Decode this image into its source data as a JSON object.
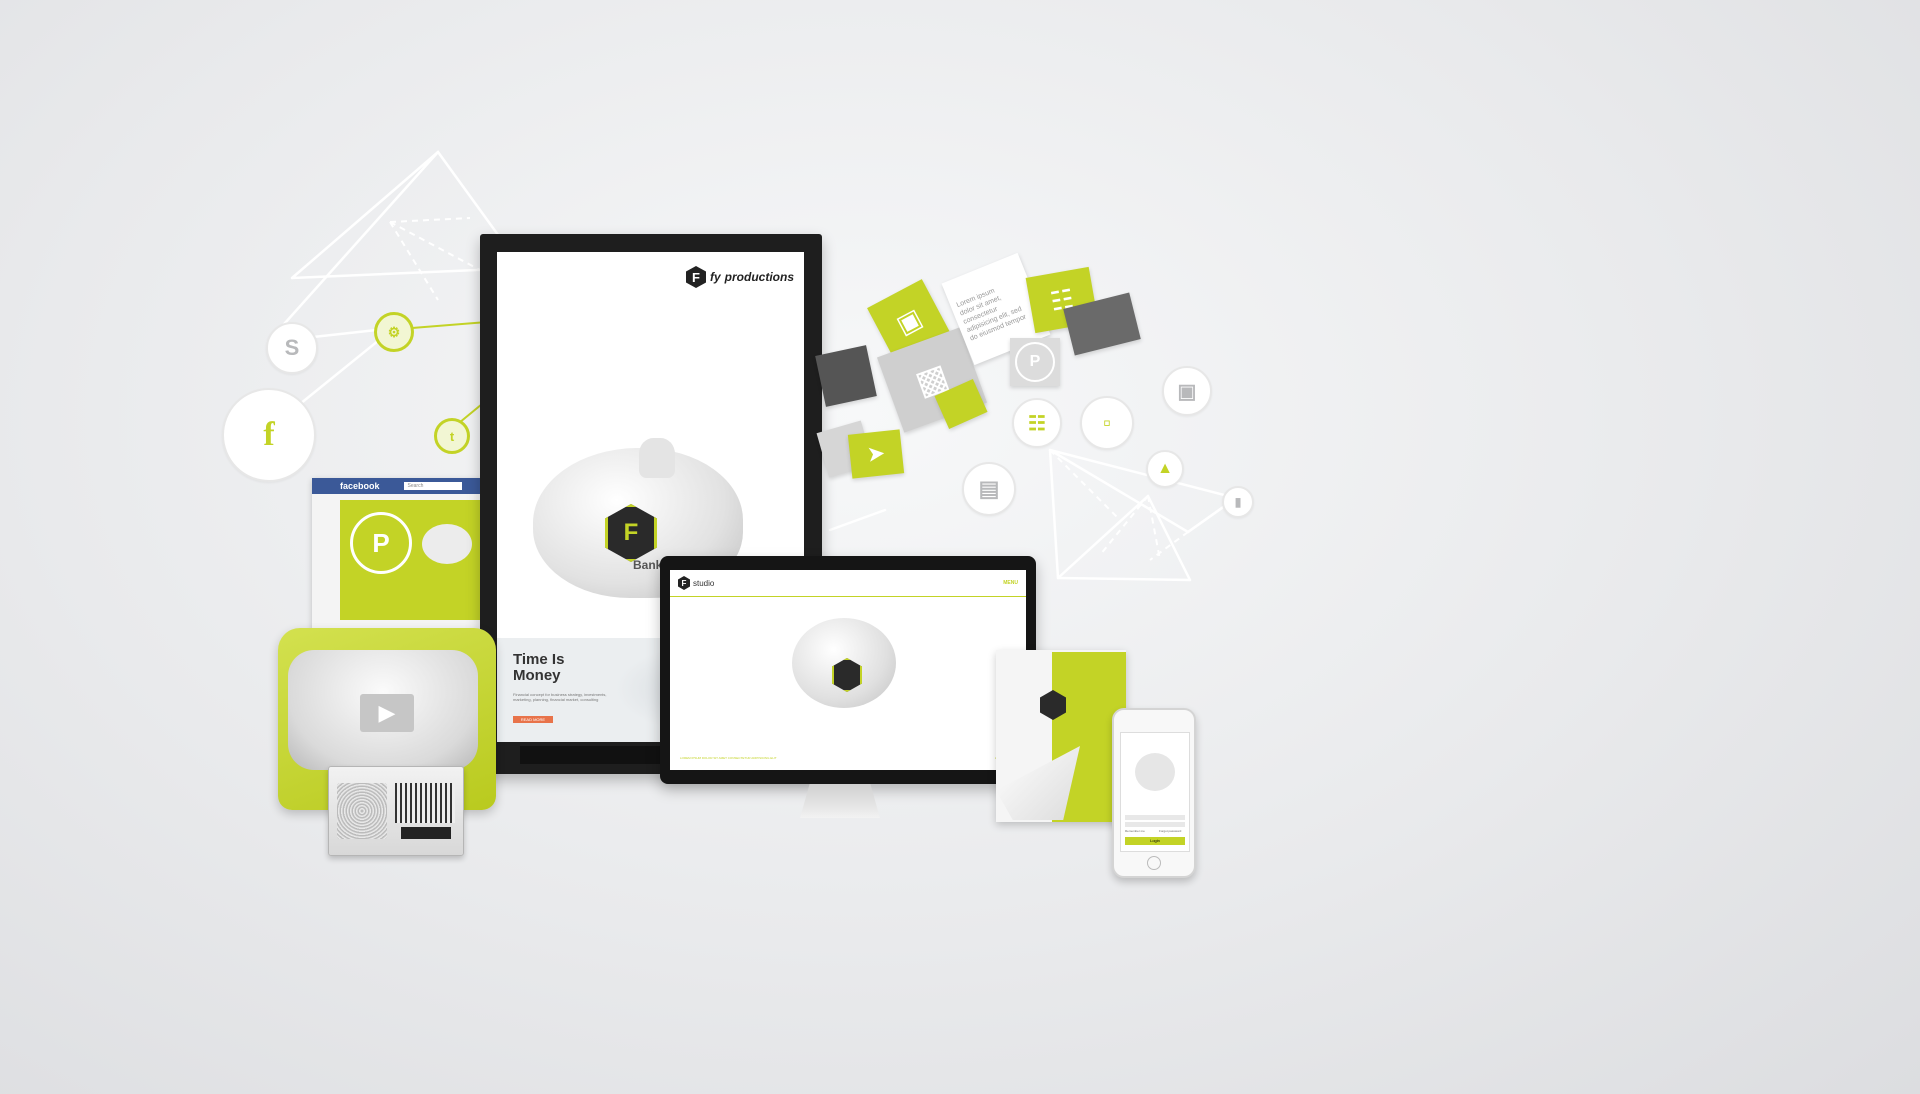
{
  "colors": {
    "accent": "#c3d326",
    "background": "#e9eaec",
    "dark": "#222222",
    "cta": "#e8734a"
  },
  "brand": {
    "monitor_logo_prefix": "fy",
    "monitor_logo_suffix": "productions",
    "bank_suffix": "Bank",
    "studio_suffix": "studio",
    "logo_letter": "F"
  },
  "social_icons": [
    "facebook-icon",
    "skype-icon",
    "github-icon",
    "twitter-icon",
    "vimeo-icon",
    "linkedin-icon",
    "pinterest-icon",
    "camera-icon",
    "document-icon",
    "presentation-icon",
    "sd-card-icon"
  ],
  "facebook_page": {
    "brand": "facebook",
    "search_placeholder": "Search"
  },
  "monitor": {
    "headline_line1": "Time Is",
    "headline_line2": "Money",
    "body": "Financial concept for business strategy, investments, marketing, planning, financial market, consulting",
    "button": "READ MORE"
  },
  "imac": {
    "menu": "MENU",
    "footer_left": "LOREM IPSUM DOLOR SIT AMET CONSECTETUR ADIPISICING ELIT",
    "footer_right": "LOREM IPSUM"
  },
  "floating_card": {
    "line1": "Lorem ipsum",
    "line2": "dolor sit amet,",
    "line3": "consectetur",
    "line4": "adipisicing elit, sed",
    "line5": "do eiusmod tempor"
  },
  "phone": {
    "button": "Login",
    "remember": "Remember me",
    "forgot": "Forgot password"
  }
}
